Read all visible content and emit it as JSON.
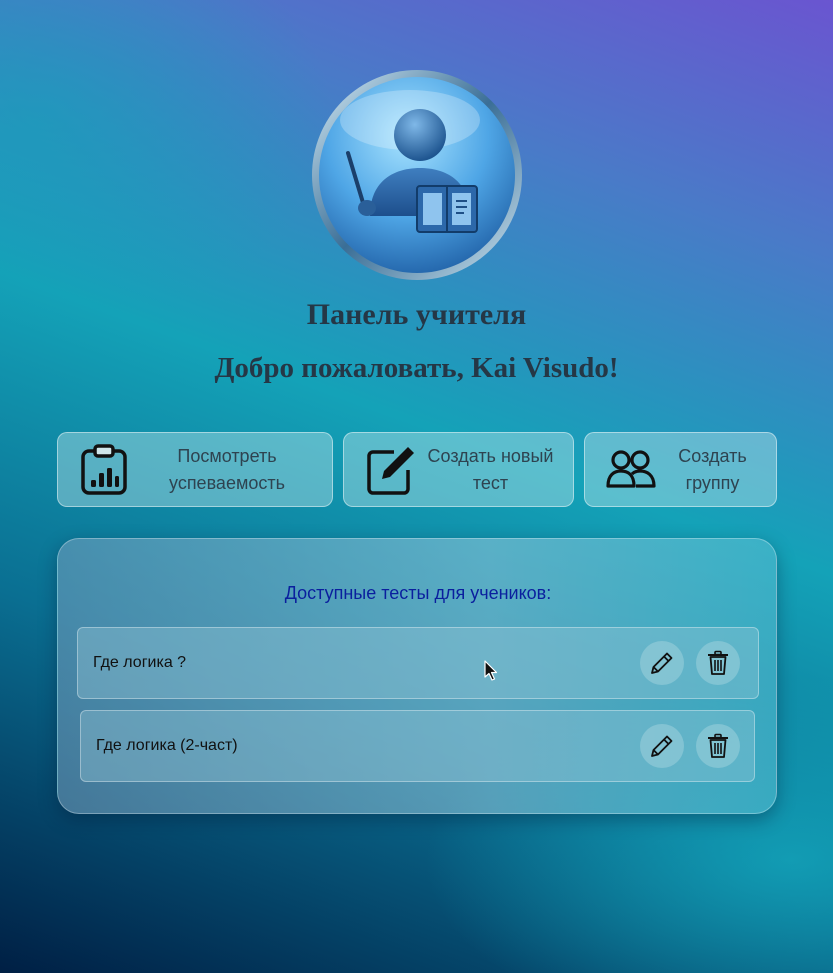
{
  "header": {
    "title": "Панель учителя",
    "welcome_prefix": "Добро пожаловать, ",
    "user_name": "Kai Visudo",
    "welcome_suffix": "!"
  },
  "actions": {
    "view_progress": {
      "label": "Посмотреть успеваемость",
      "icon": "clipboard-chart-icon"
    },
    "create_test": {
      "label": "Создать новый тест",
      "icon": "edit-note-icon"
    },
    "create_group": {
      "label": "Создать группу",
      "icon": "users-icon"
    }
  },
  "tests_panel": {
    "heading": "Доступные тесты для учеников:",
    "items": [
      {
        "name": "Где логика ?",
        "edit_icon": "pencil-icon",
        "delete_icon": "trash-icon"
      },
      {
        "name": "Где логика (2-част)",
        "edit_icon": "pencil-icon",
        "delete_icon": "trash-icon"
      }
    ]
  },
  "colors": {
    "title_text": "#253746",
    "heading_blue": "#0a1f9e",
    "button_text": "#2e4350"
  }
}
